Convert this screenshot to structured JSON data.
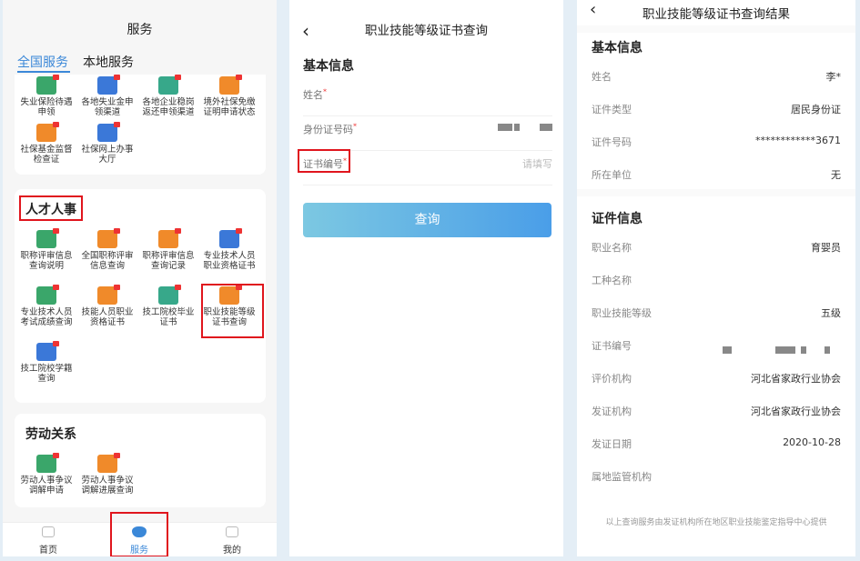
{
  "panel1": {
    "title": "服务",
    "tabs": [
      "全国服务",
      "本地服务"
    ],
    "top_items": [
      {
        "l1": "失业保险待遇",
        "l2": "申领",
        "icon": "unemployment-icon",
        "color": "green"
      },
      {
        "l1": "各地失业金申",
        "l2": "领渠道",
        "icon": "channel-icon",
        "color": "blue"
      },
      {
        "l1": "各地企业稳岗",
        "l2": "返还申领渠道",
        "icon": "refund-icon",
        "color": "teal"
      },
      {
        "l1": "境外社保免缴",
        "l2": "证明申请状态",
        "icon": "overseas-icon",
        "color": "orange"
      },
      {
        "l1": "社保基金监督",
        "l2": "检查证",
        "icon": "fund-icon",
        "color": "orange"
      },
      {
        "l1": "社保网上办事",
        "l2": "大厅",
        "icon": "online-hall-icon",
        "color": "blue"
      }
    ],
    "talent_title": "人才人事",
    "talent_items": [
      {
        "l1": "职称评审信息",
        "l2": "查询说明",
        "icon": "title-review-icon",
        "color": "green"
      },
      {
        "l1": "全国职称评审",
        "l2": "信息查询",
        "icon": "national-review-icon",
        "color": "orange"
      },
      {
        "l1": "职称评审信息",
        "l2": "查询记录",
        "icon": "review-record-icon",
        "color": "orange"
      },
      {
        "l1": "专业技术人员",
        "l2": "职业资格证书",
        "icon": "shield-cert-icon",
        "color": "blue"
      },
      {
        "l1": "专业技术人员",
        "l2": "考试成绩查询",
        "icon": "exam-score-icon",
        "color": "green"
      },
      {
        "l1": "技能人员职业",
        "l2": "资格证书",
        "icon": "skill-cert-icon",
        "color": "orange"
      },
      {
        "l1": "技工院校毕业",
        "l2": "证书",
        "icon": "graduation-cert-icon",
        "color": "teal"
      },
      {
        "l1": "职业技能等级",
        "l2": "证书查询",
        "icon": "skill-level-icon",
        "color": "orange"
      },
      {
        "l1": "技工院校学籍",
        "l2": "查询",
        "icon": "student-status-icon",
        "color": "blue"
      }
    ],
    "labor_title": "劳动关系",
    "labor_items": [
      {
        "l1": "劳动人事争议",
        "l2": "调解申请",
        "icon": "mediation-apply-icon",
        "color": "green"
      },
      {
        "l1": "劳动人事争议",
        "l2": "调解进展查询",
        "icon": "mediation-progress-icon",
        "color": "orange"
      }
    ],
    "nav": [
      "首页",
      "服务",
      "我的"
    ]
  },
  "panel2": {
    "title": "职业技能等级证书查询",
    "section": "基本信息",
    "fields": [
      {
        "label": "姓名",
        "value": ""
      },
      {
        "label": "身份证号码",
        "value": ""
      },
      {
        "label": "证书编号",
        "value": "请填写"
      }
    ],
    "button": "查询"
  },
  "panel3": {
    "title": "职业技能等级证书查询结果",
    "basic_title": "基本信息",
    "basic": [
      {
        "label": "姓名",
        "value": "李*"
      },
      {
        "label": "证件类型",
        "value": "居民身份证"
      },
      {
        "label": "证件号码",
        "value": "************3671"
      },
      {
        "label": "所在单位",
        "value": "无"
      }
    ],
    "cert_title": "证件信息",
    "cert": [
      {
        "label": "职业名称",
        "value": "育婴员"
      },
      {
        "label": "工种名称",
        "value": ""
      },
      {
        "label": "职业技能等级",
        "value": "五级"
      },
      {
        "label": "证书编号",
        "value": ""
      },
      {
        "label": "评价机构",
        "value": "河北省家政行业协会"
      },
      {
        "label": "发证机构",
        "value": "河北省家政行业协会"
      },
      {
        "label": "发证日期",
        "value": "2020-10-28"
      },
      {
        "label": "属地监管机构",
        "value": ""
      }
    ],
    "footer": "以上查询服务由发证机构所在地区职业技能鉴定指导中心提供"
  }
}
